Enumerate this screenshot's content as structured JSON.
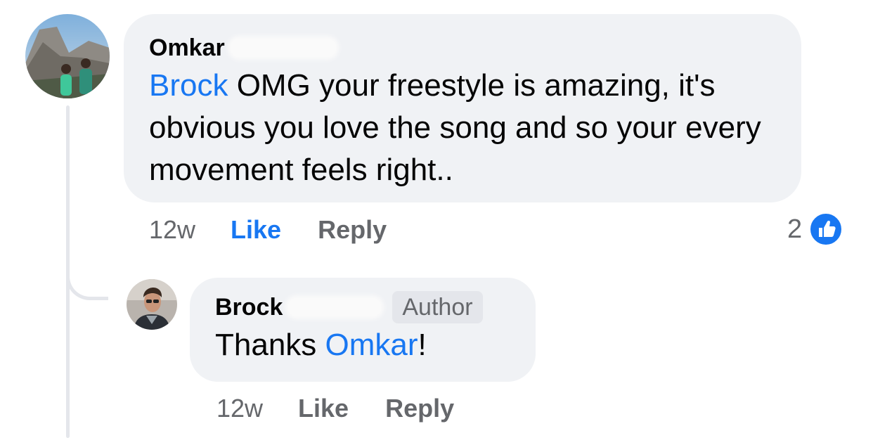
{
  "comment": {
    "author_name": "Omkar",
    "mention": "Brock",
    "text": " OMG your freestyle is amazing, it's obvious you love the song and so your every movement feels right..",
    "time": "12w",
    "like_label": "Like",
    "reply_label": "Reply",
    "reaction_count": "2",
    "reaction_icon": "like-icon",
    "accent_color": "#1877f2"
  },
  "reply": {
    "author_name": "Brock",
    "badge": "Author",
    "text_before": "Thanks ",
    "mention": "Omkar",
    "text_after": "!",
    "time": "12w",
    "like_label": "Like",
    "reply_label": "Reply"
  }
}
